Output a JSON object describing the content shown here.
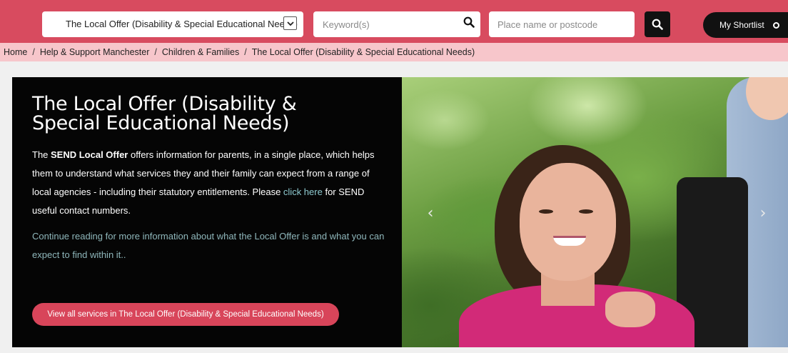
{
  "header": {
    "directory_select": {
      "selected": "The Local Offer (Disability & Special Educational Needs)"
    },
    "keyword": {
      "placeholder": "Keyword(s)",
      "value": ""
    },
    "location": {
      "placeholder": "Place name or postcode",
      "value": ""
    },
    "shortlist_label": "My Shortlist"
  },
  "breadcrumb": {
    "items": [
      "Home",
      "Help & Support Manchester",
      "Children & Families"
    ],
    "current": "The Local Offer (Disability & Special Educational Needs)",
    "separator": "/"
  },
  "panel": {
    "title": "The Local Offer (Disability & Special Educational Needs)",
    "intro_prefix": "The ",
    "intro_bold": "SEND Local Offer",
    "intro_text": " offers information for parents, in a single place, which helps them to understand what services they and their family can expect from a range of local agencies - including their statutory entitlements. Please ",
    "intro_link": "click here",
    "intro_suffix": " for SEND useful contact numbers.",
    "more_text": "Continue reading for more information about what the Local Offer is and what you can expect to find within it..",
    "cta_label": "View all services in The Local Offer (Disability & Special Educational Needs)"
  },
  "carousel": {
    "prev_glyph": "‹",
    "next_glyph": "›"
  },
  "colors": {
    "brand": "#d84b5f",
    "breadcrumb_bg": "#f7c6cb",
    "panel_bg": "#050505",
    "link": "#8fcbd1",
    "cta": "#d8455a"
  }
}
